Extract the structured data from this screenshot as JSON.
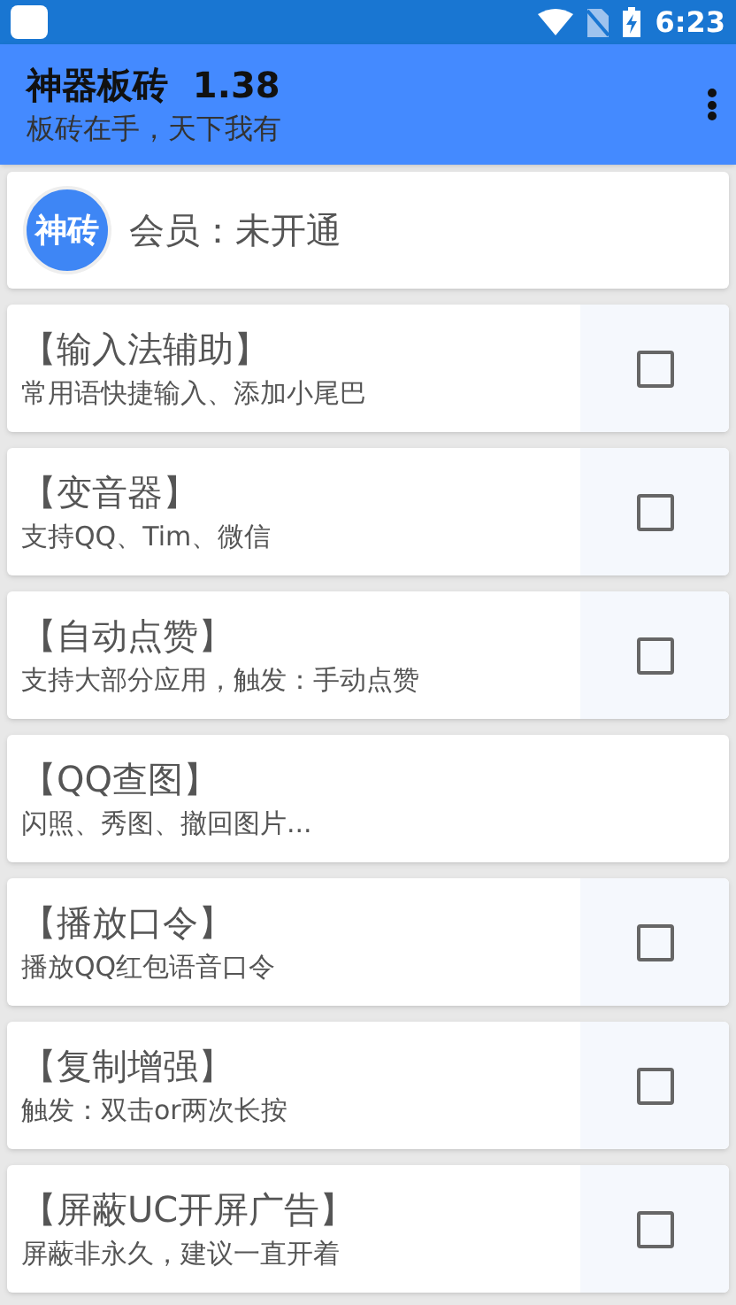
{
  "status_bar": {
    "time": "6:23"
  },
  "app_bar": {
    "title": "神器板砖  1.38",
    "subtitle": "板砖在手，天下我有"
  },
  "member": {
    "logo": "神砖",
    "text": "会员：未开通"
  },
  "features": [
    {
      "kind": "checkbox",
      "title": "【输入法辅助】",
      "description": "常用语快捷输入、添加小尾巴",
      "checked": false
    },
    {
      "kind": "checkbox",
      "title": "【变音器】",
      "description": "支持QQ、Tim、微信",
      "checked": false
    },
    {
      "kind": "checkbox",
      "title": "【自动点赞】",
      "description": "支持大部分应用，触发：手动点赞",
      "checked": false
    },
    {
      "kind": "link",
      "title": "【QQ查图】",
      "description": "闪照、秀图、撤回图片..."
    },
    {
      "kind": "checkbox",
      "title": "【播放口令】",
      "description": "播放QQ红包语音口令",
      "checked": false
    },
    {
      "kind": "checkbox",
      "title": "【复制增强】",
      "description": "触发：双击or两次长按",
      "checked": false
    },
    {
      "kind": "checkbox",
      "title": "【屏蔽UC开屏广告】",
      "description": "屏蔽非永久，建议一直开着",
      "checked": false
    }
  ]
}
